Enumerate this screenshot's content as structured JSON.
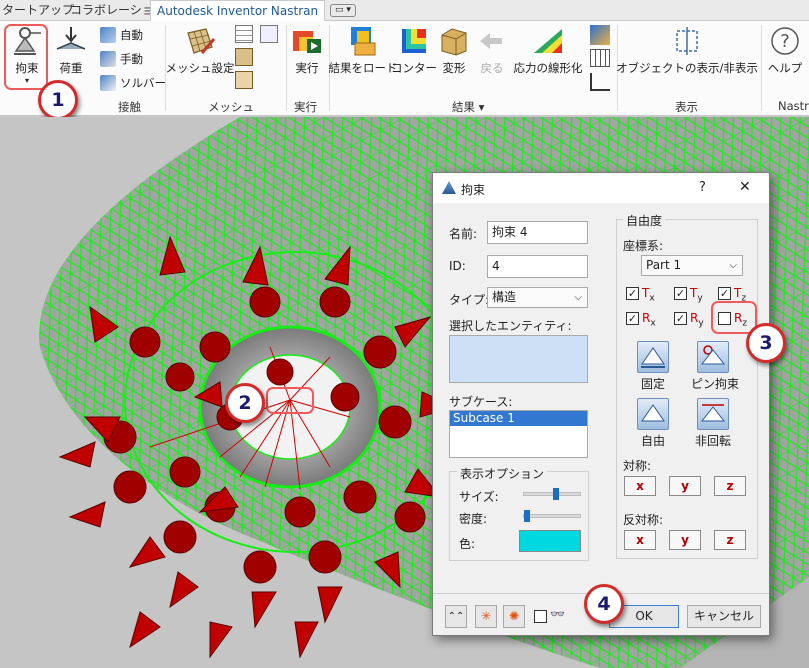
{
  "tabs": [
    "タートアップ",
    "コラボレーション",
    "Autodesk Inventor Nastran"
  ],
  "qat_label": "",
  "ribbon": {
    "constraint": "拘束",
    "load": "荷重",
    "contact_auto": "自動",
    "contact_manual": "手動",
    "contact_solver": "ソルバー",
    "group_contact": "接触",
    "mesh_settings": "メッシュ設定",
    "group_mesh": "メッシュ",
    "run": "実行",
    "group_run": "実行",
    "load_results": "結果をロード",
    "contour": "コンター",
    "deform": "変形",
    "back": "戻る",
    "linearize": "応力の線形化",
    "group_results": "結果 ▾",
    "object_visibility": "オブジェクトの表示/非表示",
    "group_display": "表示",
    "help": "ヘルプ",
    "group_nastran": "Nastra"
  },
  "callouts": [
    "1",
    "2",
    "3",
    "4"
  ],
  "dialog": {
    "title": "拘束",
    "help": "?",
    "close": "✕",
    "name_label": "名前:",
    "name_value": "拘束 4",
    "id_label": "ID:",
    "id_value": "4",
    "type_label": "タイプ:",
    "type_value": "構造",
    "selected_label": "選択したエンティティ:",
    "subcase_label": "サブケース:",
    "subcase_item": "Subcase 1",
    "display_options": "表示オプション",
    "size_label": "サイズ:",
    "size_value": 0.55,
    "density_label": "密度:",
    "density_value": 0.0,
    "color_label": "色:",
    "color_value": "#00d8e0",
    "dof_title": "自由度",
    "coord_label": "座標系:",
    "coord_value": "Part 1",
    "dofs": [
      {
        "main": "T",
        "sub": "x",
        "checked": true
      },
      {
        "main": "T",
        "sub": "y",
        "checked": true
      },
      {
        "main": "T",
        "sub": "z",
        "checked": true
      },
      {
        "main": "R",
        "sub": "x",
        "checked": true
      },
      {
        "main": "R",
        "sub": "y",
        "checked": true
      },
      {
        "main": "R",
        "sub": "z",
        "checked": false
      }
    ],
    "fixed": "固定",
    "pin": "ピン拘束",
    "free": "自由",
    "no_rotation": "非回転",
    "symmetry": "対称:",
    "antisymmetry": "反対称:",
    "x": "x",
    "y": "y",
    "z": "z",
    "ok": "OK",
    "cancel": "キャンセル"
  }
}
